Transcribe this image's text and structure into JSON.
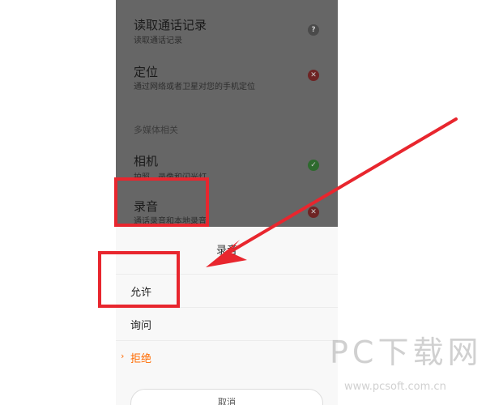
{
  "permissions": {
    "items": [
      {
        "title": "读取通话记录",
        "subtitle": "读取通话记录",
        "status": "ask",
        "status_glyph": "?"
      },
      {
        "title": "定位",
        "subtitle": "通过网络或者卫星对您的手机定位",
        "status": "deny",
        "status_glyph": "✕"
      },
      {
        "title": "相机",
        "subtitle": "拍照、录像和闪光灯",
        "status": "allow",
        "status_glyph": "✓"
      },
      {
        "title": "录音",
        "subtitle": "通话录音和本地录音",
        "status": "deny",
        "status_glyph": "✕"
      }
    ],
    "section_label": "多媒体相关"
  },
  "sheet": {
    "title": "录音",
    "options": [
      {
        "label": "允许",
        "selected": false
      },
      {
        "label": "询问",
        "selected": false
      },
      {
        "label": "拒绝",
        "selected": true
      }
    ],
    "selected_marker": "›",
    "cancel_label": "取消"
  },
  "watermark": {
    "brand": "PC下载网",
    "url": "www.pcsoft.com.cn"
  },
  "colors": {
    "highlight": "#e8262e",
    "accent": "#ff6a00",
    "allow_icon": "#2e6a2e",
    "deny_icon": "#6e2424",
    "ask_icon": "#4a4a4a",
    "overlay": "#666666"
  },
  "icons": {
    "ask": "question-icon",
    "deny": "deny-icon",
    "allow": "check-icon",
    "selected": "chevron-right-icon"
  }
}
